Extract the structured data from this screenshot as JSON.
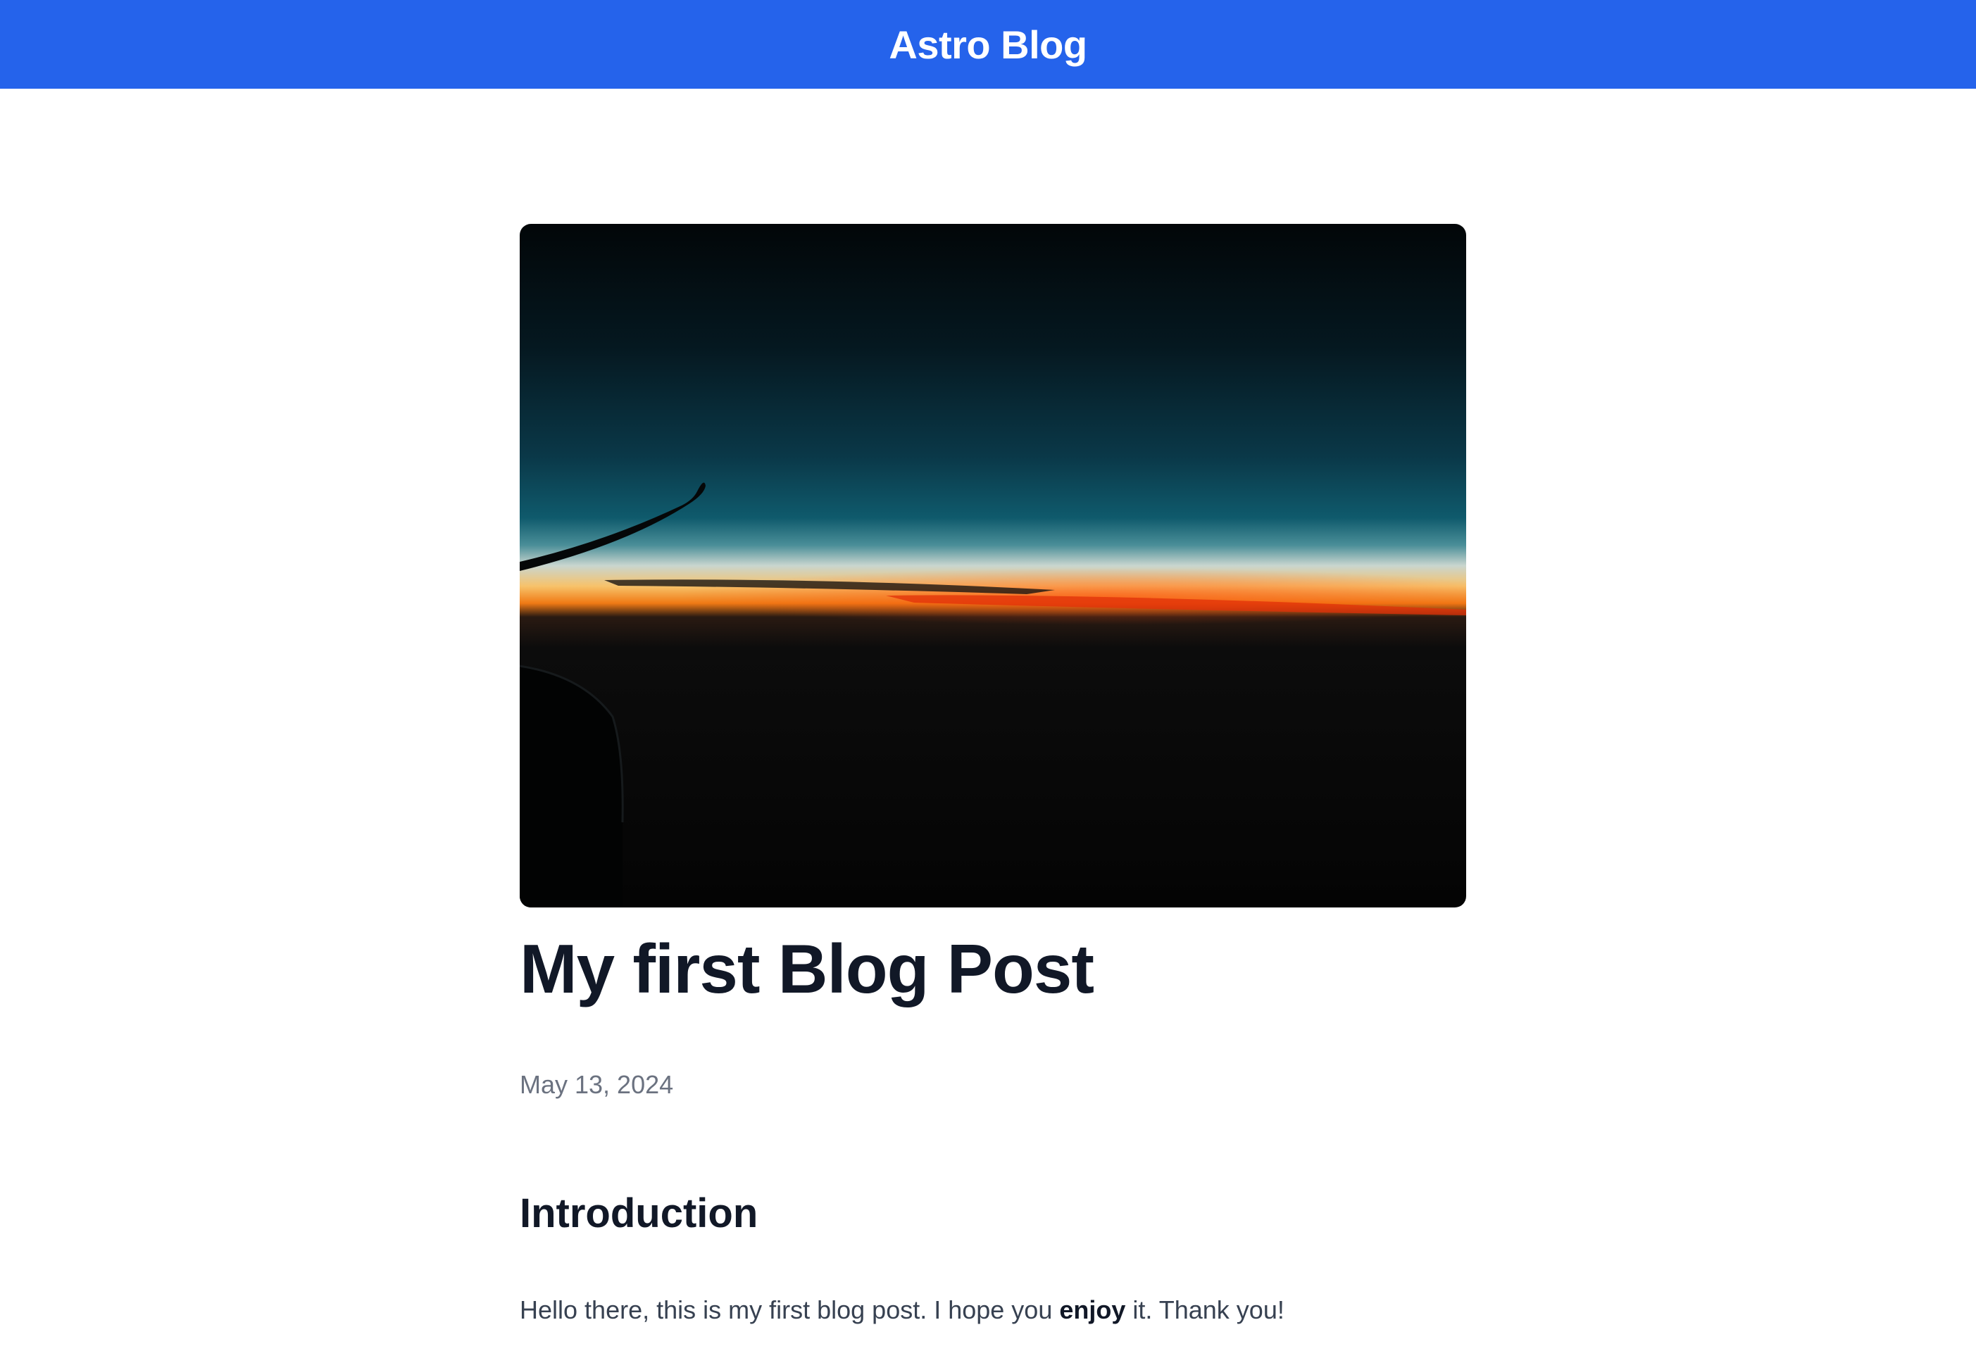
{
  "header": {
    "site_title": "Astro Blog",
    "background_color": "#2563eb"
  },
  "hero_image": {
    "description_icon": "airplane-wing-sunset-image"
  },
  "post": {
    "title": "My first Blog Post",
    "date": "May 13, 2024",
    "sections": [
      {
        "heading": "Introduction",
        "body_before": "Hello there, this is my first blog post. I hope you ",
        "body_bold": "enjoy",
        "body_after": " it. Thank you!"
      }
    ]
  }
}
